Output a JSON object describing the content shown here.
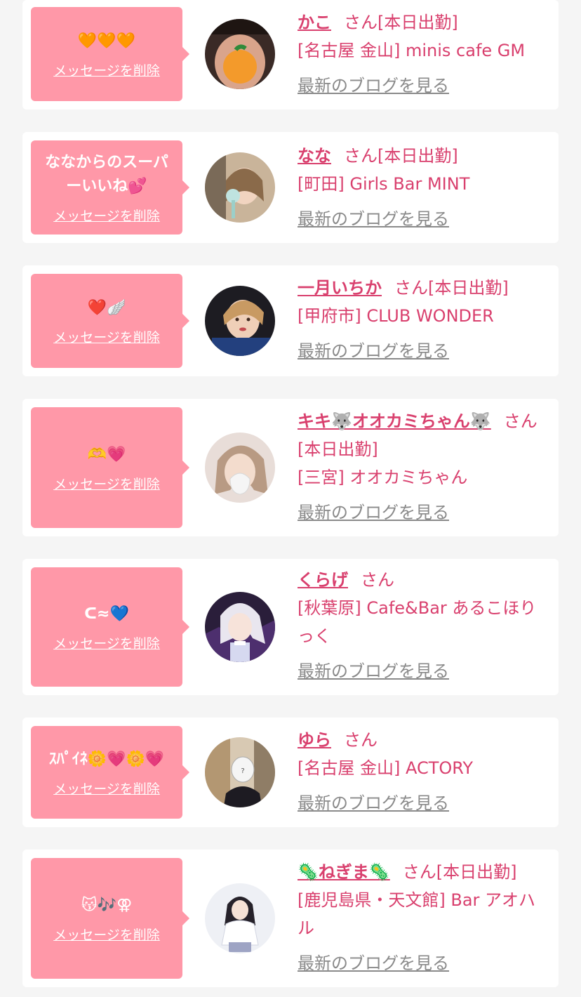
{
  "cards": [
    {
      "message": "🧡🧡🧡",
      "delete_label": "メッセージを削除",
      "name": "かこ",
      "honorific": "さん",
      "status": "[本日出勤]",
      "shop": "[名古屋 金山] minis cafe GM",
      "blog_label": "最新のブログを見る"
    },
    {
      "message": "ななからのスーパーいいね💕",
      "delete_label": "メッセージを削除",
      "name": "なな",
      "honorific": "さん",
      "status": "[本日出勤]",
      "shop": "[町田] Girls Bar MINT",
      "blog_label": "最新のブログを見る"
    },
    {
      "message": "❤️🪽",
      "delete_label": "メッセージを削除",
      "name": "一月いちか",
      "honorific": "さん",
      "status": "[本日出勤]",
      "shop": "[甲府市] CLUB WONDER",
      "blog_label": "最新のブログを見る"
    },
    {
      "message": "🫶💗",
      "delete_label": "メッセージを削除",
      "name": "キキ🐺オオカミちゃん🐺",
      "honorific": "さん",
      "status": "[本日出勤]",
      "shop": "[三宮] オオカミちゃん",
      "blog_label": "最新のブログを見る"
    },
    {
      "message": "ᑕ≈💙",
      "delete_label": "メッセージを削除",
      "name": "くらげ",
      "honorific": "さん",
      "status": "",
      "shop": "[秋葉原] Cafe&Bar あるこほりっく",
      "blog_label": "最新のブログを見る"
    },
    {
      "message": "ｽﾊﾟｲﾈ🌼💗🌼💗",
      "delete_label": "メッセージを削除",
      "name": "ゆら",
      "honorific": "さん",
      "status": "",
      "shop": "[名古屋 金山] ACTORY",
      "blog_label": "最新のブログを見る"
    },
    {
      "message": "😽🎶⚢",
      "delete_label": "メッセージを削除",
      "name": "🦠ねぎま🦠",
      "honorific": "さん",
      "status": "[本日出勤]",
      "shop": "[鹿児島県・天文館] Bar アオハル",
      "blog_label": "最新のブログを見る"
    }
  ],
  "colors": {
    "bubble": "#ff98a8",
    "accent": "#d9406e",
    "link_gray": "#8a8a8a",
    "background": "#f5f5f5"
  }
}
